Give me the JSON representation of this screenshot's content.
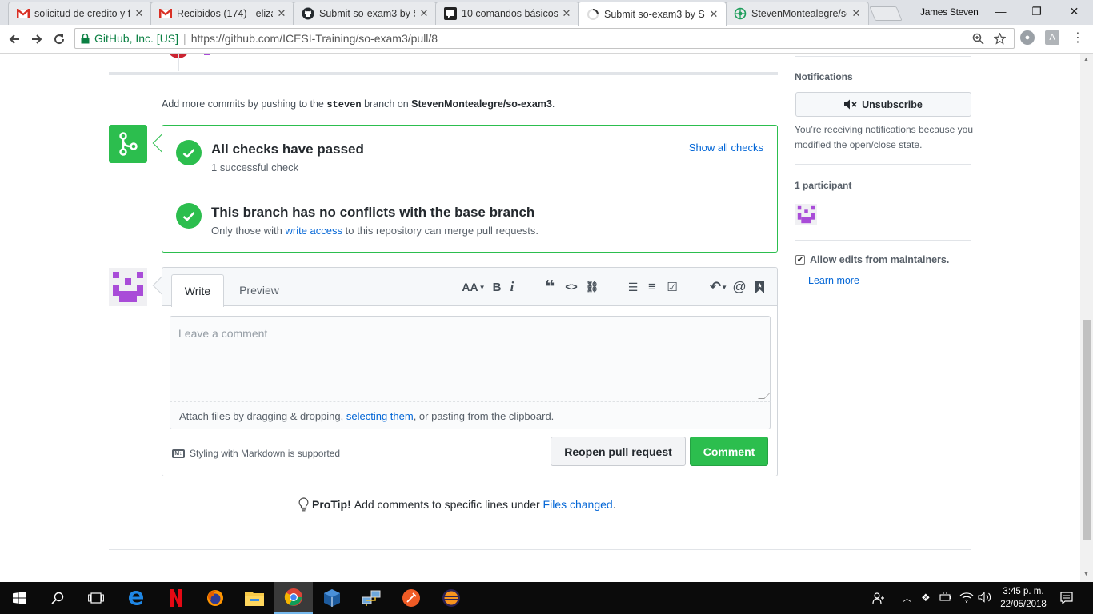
{
  "browser": {
    "tabs": [
      {
        "title": "solicitud de credito y fi",
        "icon": "gmail-icon",
        "active": false
      },
      {
        "title": "Recibidos (174) - elizag",
        "icon": "gmail-icon",
        "active": false
      },
      {
        "title": "Submit so-exam3 by S",
        "icon": "github-icon",
        "active": false
      },
      {
        "title": "10 comandos básicos",
        "icon": "quiz-icon",
        "active": false
      },
      {
        "title": "Submit so-exam3 by S",
        "icon": "github-icon",
        "active": true
      },
      {
        "title": "StevenMontealegre/so",
        "icon": "puzzle-icon",
        "active": false
      }
    ],
    "profile_name": "James Steven",
    "site_identity": "GitHub, Inc. [US]",
    "url": "https://github.com/ICESI-Training/so-exam3/pull/8"
  },
  "main": {
    "commit_hint": {
      "prefix": "Add more commits by pushing to the",
      "branch": "steven",
      "middle": "branch on",
      "repo": "StevenMontealegre/so-exam3",
      "suffix": "."
    },
    "checks": {
      "title": "All checks have passed",
      "subtitle": "1 successful check",
      "show_all": "Show all checks"
    },
    "conflicts": {
      "title": "This branch has no conflicts with the base branch",
      "sub_prefix": "Only those with",
      "sub_link": "write access",
      "sub_suffix": "to this repository can merge pull requests."
    },
    "comment": {
      "tab_write": "Write",
      "tab_preview": "Preview",
      "placeholder": "Leave a comment",
      "attach_prefix": "Attach files by dragging & dropping,",
      "attach_link": "selecting them",
      "attach_suffix": ", or pasting from the clipboard.",
      "markdown_note": "Styling with Markdown is supported",
      "reopen_label": "Reopen pull request",
      "comment_label": "Comment",
      "toolbar": {
        "header": "AA",
        "bold": "B",
        "italic": "i",
        "quote": "❝",
        "code": "<>",
        "link": "⛓",
        "ul": "☰",
        "ol": "≡",
        "tasks": "☑",
        "reply": "↶",
        "mention": "@",
        "bookmark": "🔖"
      }
    },
    "protip": {
      "bold": "ProTip!",
      "text": "Add comments to specific lines under",
      "link": "Files changed",
      "suffix": "."
    }
  },
  "sidebar": {
    "notifications_heading": "Notifications",
    "unsubscribe_label": "Unsubscribe",
    "notification_reason": "You’re receiving notifications because you modified the open/close state.",
    "participants_heading": "1 participant",
    "allow_edits_label": "Allow edits from maintainers.",
    "allow_edits_checked": true,
    "learn_more": "Learn more"
  },
  "taskbar": {
    "clock_time": "3:45 p. m.",
    "clock_date": "22/05/2018"
  },
  "colors": {
    "success_green": "#2cbe4e",
    "link_blue": "#0366d6",
    "avatar_purple": "#a94cd8",
    "closed_red": "#cb2431"
  }
}
